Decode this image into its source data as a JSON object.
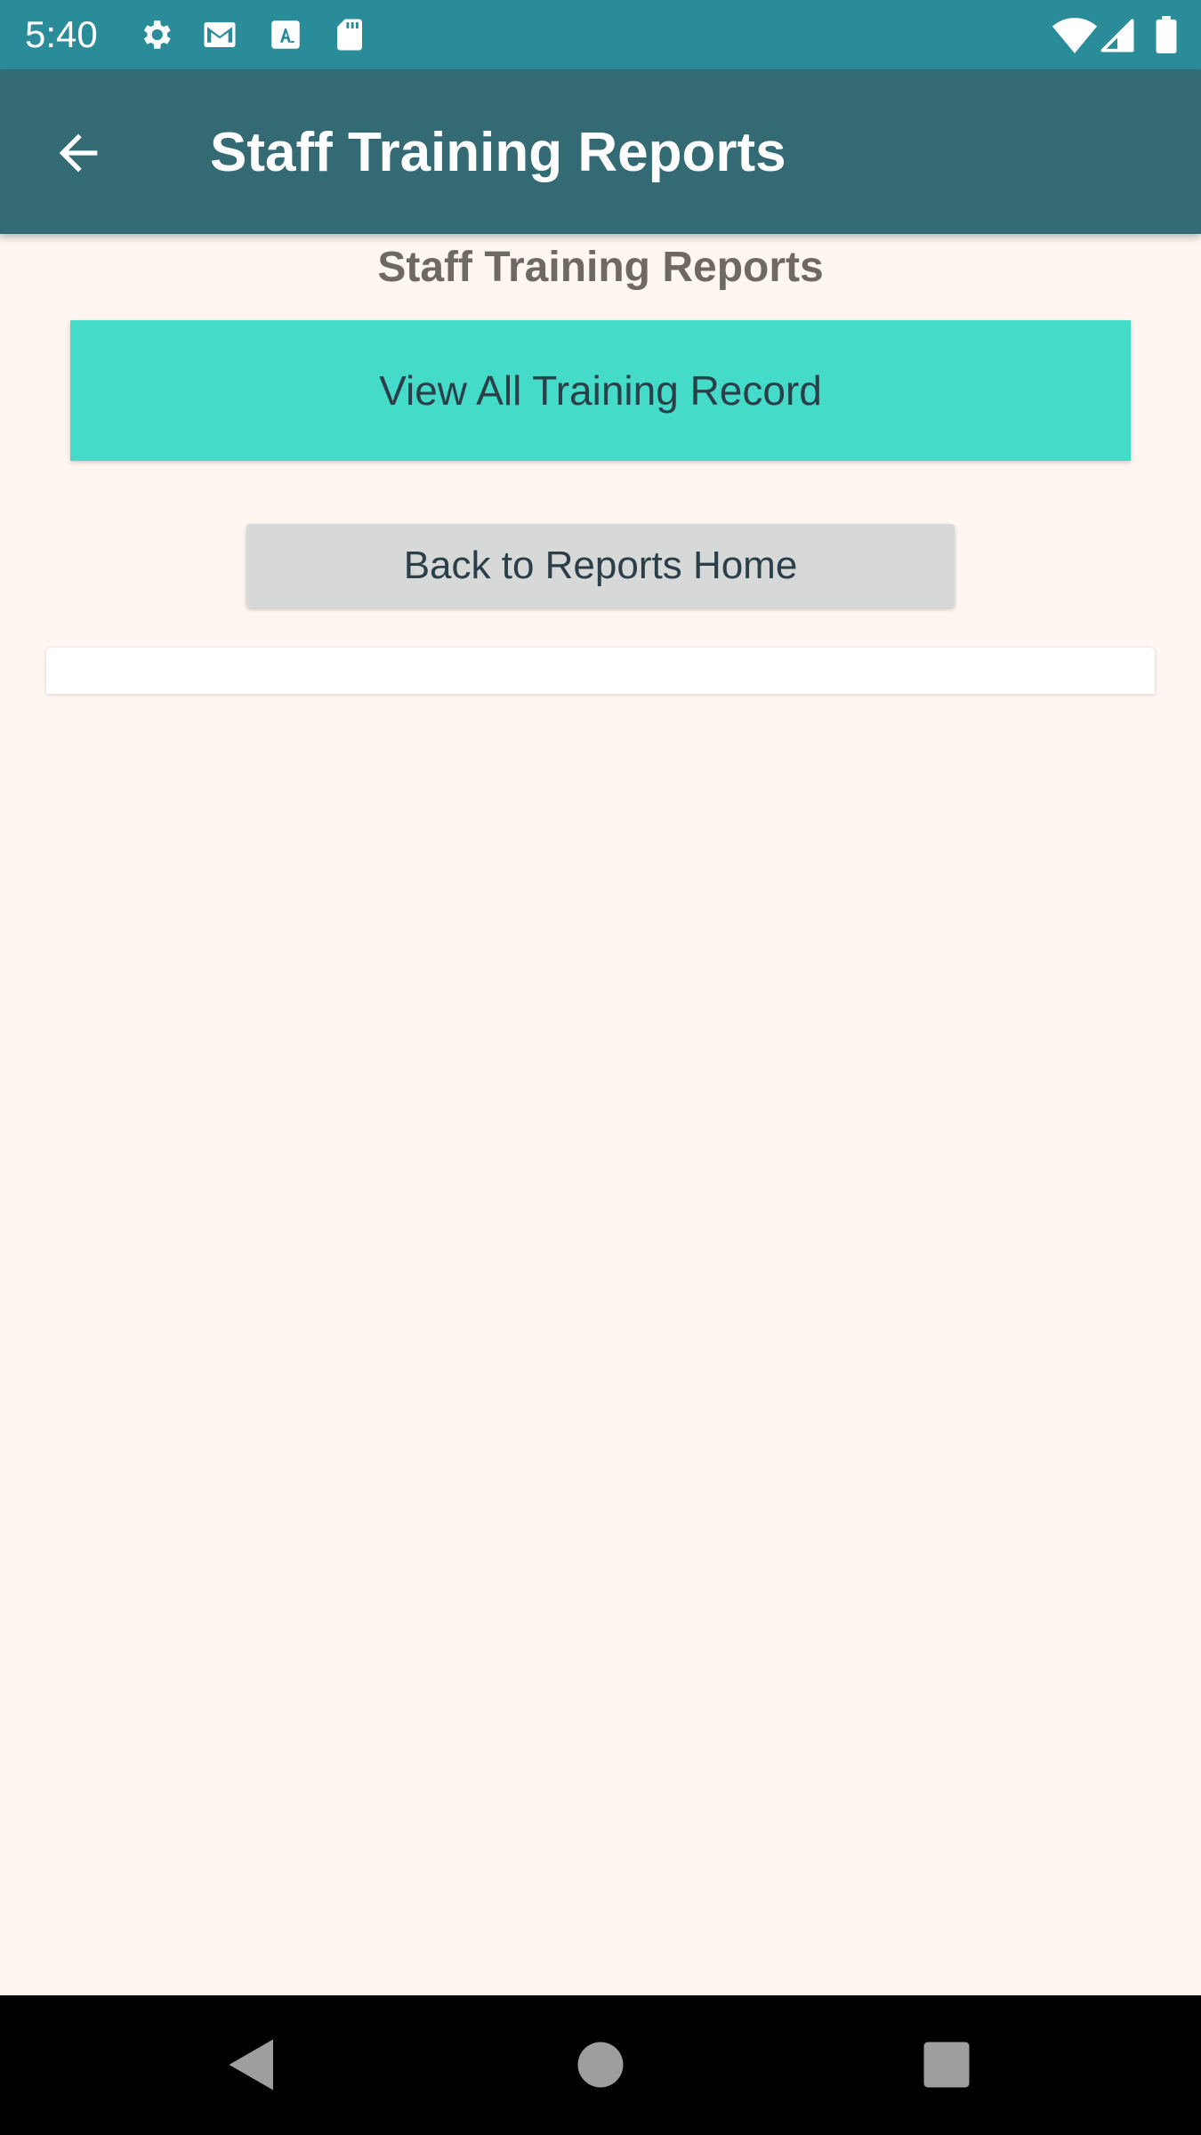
{
  "status_bar": {
    "time": "5:40",
    "icons": [
      "settings-icon",
      "gmail-icon",
      "font-icon",
      "sd-card-icon",
      "wifi-icon",
      "signal-icon",
      "battery-icon"
    ],
    "background_color": "#2b8c99"
  },
  "app_bar": {
    "title": "Staff Training Reports",
    "back_icon": "arrow-back-icon",
    "background_color": "#336a73"
  },
  "main": {
    "heading": "Staff Training Reports",
    "view_all_button_label": "View All Training Record",
    "back_button_label": "Back to Reports Home",
    "primary_color": "#44dbc9",
    "secondary_color": "#d7d8d8",
    "background_color": "#fff6f1"
  },
  "nav_bar": {
    "buttons": [
      "back-triangle-icon",
      "home-circle-icon",
      "recents-square-icon"
    ]
  }
}
